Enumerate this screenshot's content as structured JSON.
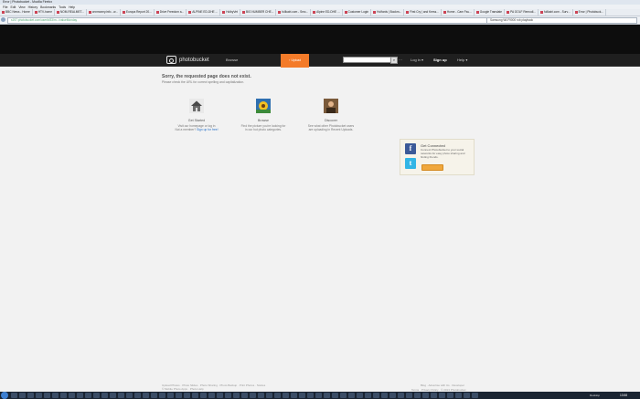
{
  "browser": {
    "title": "Error | Photobucket - Mozilla Firefox",
    "menu": [
      "File",
      "Edit",
      "View",
      "History",
      "Bookmarks",
      "Tools",
      "Help"
    ],
    "bookmarks": [
      "BBC News - Home",
      "HTV-home",
      "NOM-REALMET...",
      "cnnmoney.info - w...",
      "Europa Report 20...",
      "Drive Freedom a...",
      "ALPINE ED-DHE ...",
      "HolbyVet",
      "BIG NUMBER CHE...",
      "fullkairi.com - Smc...",
      "Alpine ED-DHE ...",
      "Customer Login",
      "Holfords | Bookm...",
      "First Cry | and Kress...",
      "Home - Cam Fsu...",
      "Google Translate",
      "PA GOLF Remodl...",
      "fullkairi.com - Surv...",
      "Error | Photobuck..."
    ],
    "url": "s197.photobucket.com/user/kf33/m.../valueMonday",
    "search": "Samsung WLF9000 rob playback"
  },
  "site": {
    "logo": "photobucket",
    "nav_browse": "Browse",
    "upload": "Upload",
    "login": "Log in",
    "signup": "Sign up",
    "help": "Help"
  },
  "error": {
    "title": "Sorry, the requested page does not exist.",
    "subtitle": "Please check the URL for correct spelling and capitalization."
  },
  "cards": [
    {
      "title": "Get Started",
      "line1": "Visit our homepage or log in",
      "line2_pre": "Not a member? ",
      "link": "Sign up for free!"
    },
    {
      "title": "Browse",
      "line1": "Find the picture you're looking for",
      "line2": "in our hot photo categories."
    },
    {
      "title": "Discover",
      "line1": "See what other Photobucket users",
      "line2": "are uploading in Recent Uploads."
    }
  ],
  "social": {
    "title": "Get Connected",
    "text": "Connect Photobucket to your social networks for easy photo sharing and finding friends.",
    "facebook_glyph": "f",
    "twitter_glyph": "t"
  },
  "footer": {
    "left1": "Upload Photos · Photo Slides · Photo Sharing · Photo Backup · Print Photos · Stories",
    "left2": "© Mobile Photo Apps · Photo Help",
    "right1": "Blog · Advertise with Us · Developer",
    "right2": "Terms · Privacy Policy · © 2013 Photobucket"
  },
  "taskbar": {
    "lang": "Desktop",
    "time": "13:58"
  },
  "colors": {
    "accent": "#f47b29",
    "link": "#2a72c8",
    "facebook": "#3b5998",
    "twitter": "#33b5e5"
  }
}
